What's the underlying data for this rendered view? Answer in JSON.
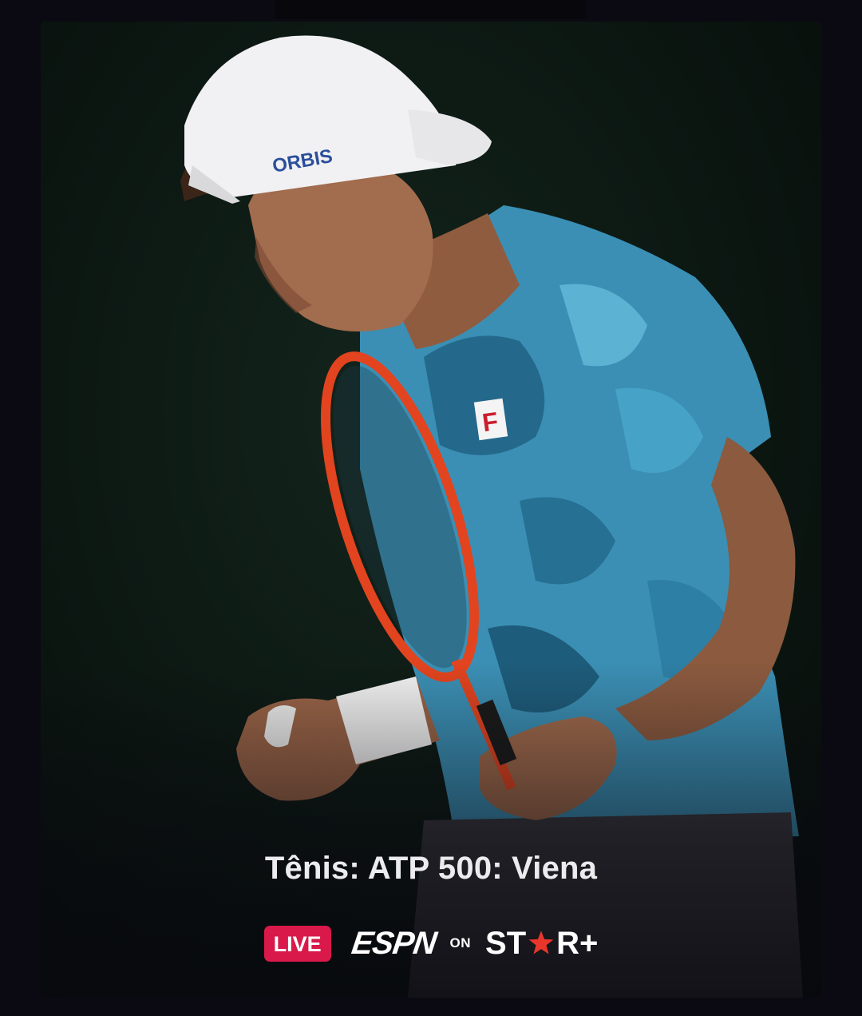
{
  "card": {
    "title": "Tênis: ATP 500: Viena",
    "live_label": "LIVE",
    "network_logo": "ESPN",
    "connector": "ON",
    "platform_logo": {
      "left": "ST",
      "right": "R+"
    },
    "cap_logo_text": "ORBIS",
    "shirt_logo_text": "F"
  },
  "colors": {
    "live_badge": "#d8194a",
    "star": "#e8362b",
    "background": "#0b0a12"
  }
}
